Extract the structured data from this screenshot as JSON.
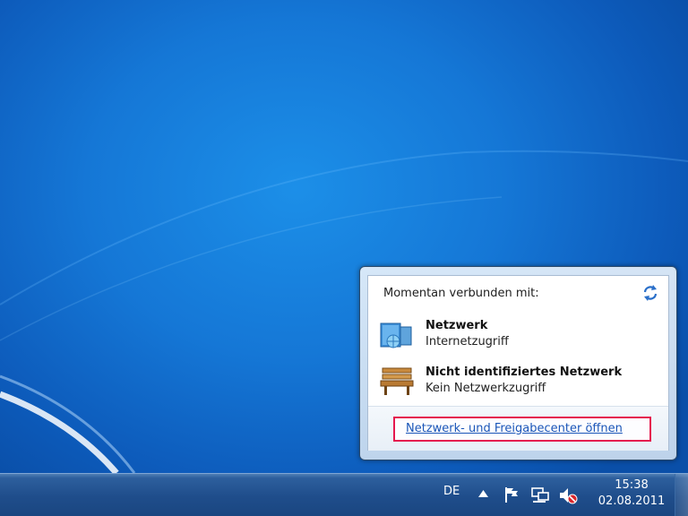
{
  "flyout": {
    "heading": "Momentan verbunden mit:",
    "refresh_icon": "refresh-arrows-icon",
    "networks": [
      {
        "name": "Netzwerk",
        "status": "Internetzugriff",
        "icon": "network-globe-icon"
      },
      {
        "name": "Nicht identifiziertes Netzwerk",
        "status": "Kein Netzwerkzugriff",
        "icon": "park-bench-icon"
      }
    ],
    "footer_link": "Netzwerk- und Freigabecenter öffnen",
    "highlight_color": "#e5174e"
  },
  "taskbar": {
    "language": "DE",
    "tray_icons": [
      "show-hidden-icons-arrow",
      "action-center-flag-icon",
      "network-icon",
      "volume-muted-icon"
    ],
    "clock": {
      "time": "15:38",
      "date": "02.08.2011"
    }
  },
  "colors": {
    "desktop": "#1577d6",
    "taskbar": "#1f4d8b",
    "link": "#1a55b8"
  }
}
